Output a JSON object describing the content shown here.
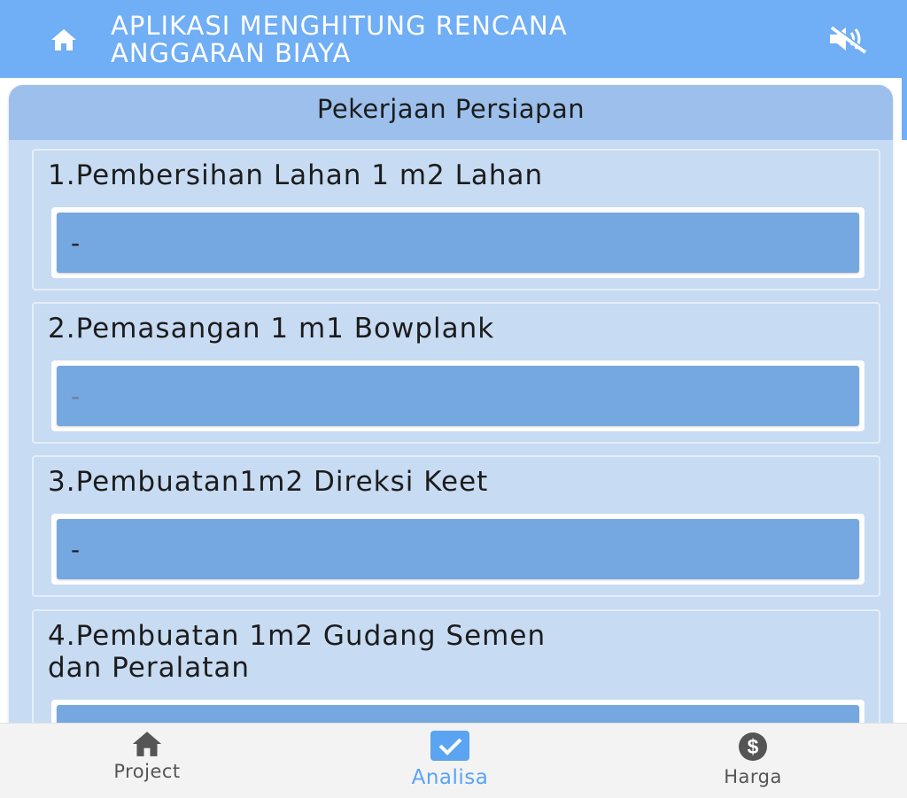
{
  "header": {
    "title_line1": "APLIKASI MENGHITUNG RENCANA",
    "title_line2": "ANGGARAN BIAYA",
    "home_icon": "home-icon",
    "mute_icon": "volume-off-icon"
  },
  "section": {
    "title": "Pekerjaan Persiapan"
  },
  "items": [
    {
      "label": "1.Pembersihan Lahan 1 m2 Lahan",
      "value": "-"
    },
    {
      "label": "2.Pemasangan 1 m1 Bowplank",
      "placeholder": "-"
    },
    {
      "label": "3.Pembuatan1m2 Direksi Keet",
      "value": "-"
    },
    {
      "label_line1": "4.Pembuatan 1m2 Gudang Semen",
      "label_line2": "dan Peralatan",
      "value": ""
    }
  ],
  "nav": {
    "items": [
      {
        "label": "Project",
        "icon": "home-icon",
        "color": "#555555"
      },
      {
        "label": "Analisa",
        "icon": "checkbox-icon",
        "color": "#5aa4f2",
        "active": true
      },
      {
        "label": "Harga",
        "icon": "dollar-icon",
        "color": "#555555"
      }
    ]
  },
  "colors": {
    "header": "#70aef5",
    "panel": "#c7dbf3",
    "panel_header": "#9cc0eb",
    "input_fill": "#75a7e0",
    "nav_active": "#5aa4f2"
  }
}
